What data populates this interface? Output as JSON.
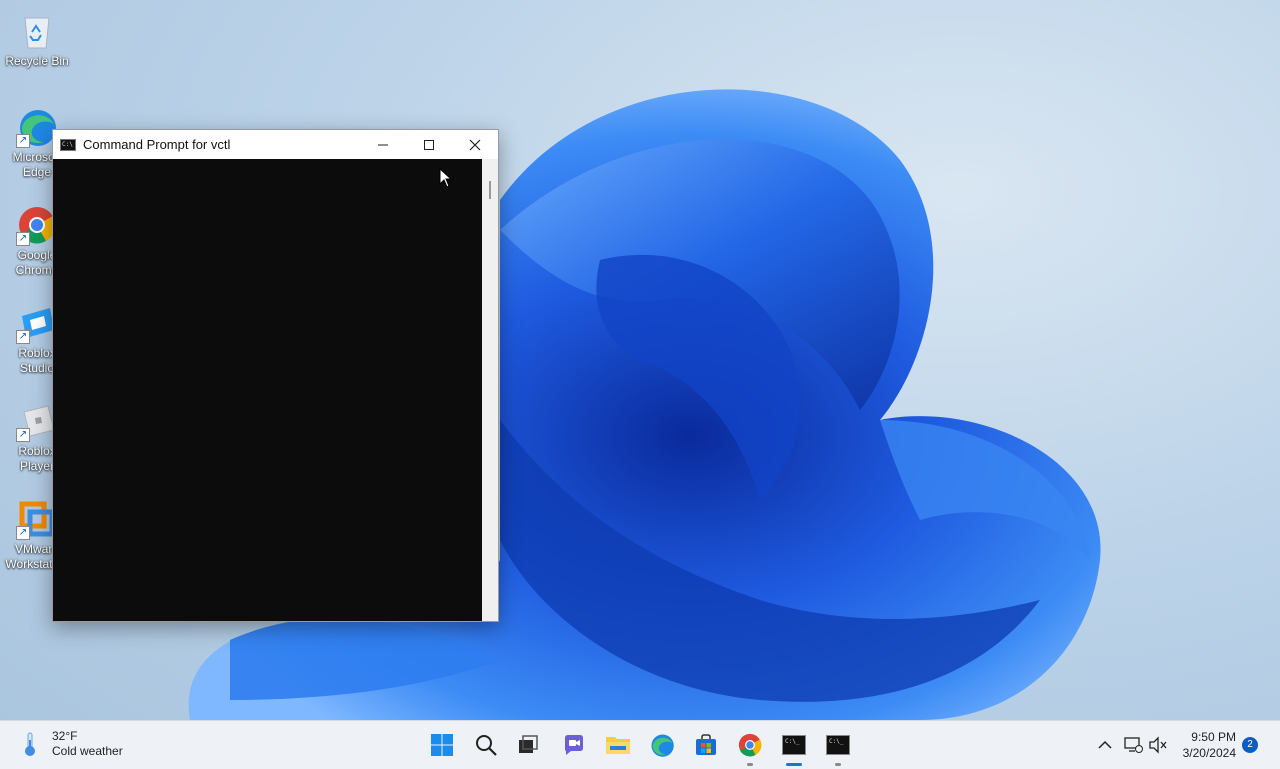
{
  "desktop": {
    "icons": [
      {
        "label": "Recycle Bin",
        "icon": "recycle-bin-icon"
      },
      {
        "label": "Microsoft Edge",
        "icon": "edge-icon"
      },
      {
        "label": "Google Chrome",
        "icon": "chrome-icon"
      },
      {
        "label": "Roblox Studio",
        "icon": "roblox-studio-icon"
      },
      {
        "label": "Roblox Player",
        "icon": "roblox-player-icon"
      },
      {
        "label": "VMware Workstation",
        "icon": "vmware-icon"
      }
    ]
  },
  "window": {
    "title": "Command Prompt for vctl",
    "minimize_icon": "minimize-icon",
    "maximize_icon": "maximize-icon",
    "close_icon": "close-icon",
    "console_bg": "#0c0c0c"
  },
  "taskbar": {
    "weather": {
      "temp": "32°F",
      "desc": "Cold weather",
      "icon": "thermometer-icon"
    },
    "apps": [
      {
        "name": "Start",
        "icon": "windows-start-icon"
      },
      {
        "name": "Search",
        "icon": "search-icon"
      },
      {
        "name": "Task View",
        "icon": "task-view-icon"
      },
      {
        "name": "Chat",
        "icon": "chat-icon"
      },
      {
        "name": "File Explorer",
        "icon": "folder-icon"
      },
      {
        "name": "Microsoft Edge",
        "icon": "edge-icon"
      },
      {
        "name": "Microsoft Store",
        "icon": "store-icon"
      },
      {
        "name": "Google Chrome",
        "icon": "chrome-icon"
      },
      {
        "name": "Command Prompt",
        "icon": "terminal-icon"
      },
      {
        "name": "Command Prompt",
        "icon": "terminal-icon"
      }
    ],
    "time": "9:50 PM",
    "date": "3/20/2024",
    "notification_count": "2",
    "accent": "#1a73d9"
  }
}
